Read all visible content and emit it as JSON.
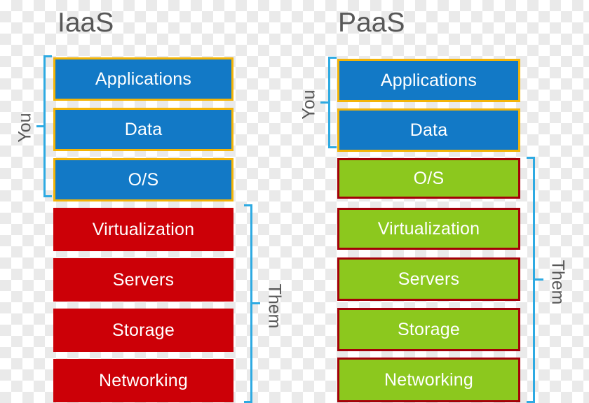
{
  "diagram": {
    "title_left": "IaaS",
    "title_right": "PaaS",
    "colors": {
      "blue_fill": "#1279c6",
      "blue_border": "#f3b408",
      "red_fill": "#cc0007",
      "green_fill": "#8cc81e",
      "green_border": "#a40009",
      "bracket": "#2eaae2",
      "title_text": "#585858",
      "layer_text": "#ffffff"
    }
  },
  "iaas": {
    "title": "IaaS",
    "you_label": "You",
    "them_label": "Them",
    "layers": [
      {
        "label": "Applications",
        "owner": "you",
        "style": "blue"
      },
      {
        "label": "Data",
        "owner": "you",
        "style": "blue"
      },
      {
        "label": "O/S",
        "owner": "you",
        "style": "blue"
      },
      {
        "label": "Virtualization",
        "owner": "them",
        "style": "red"
      },
      {
        "label": "Servers",
        "owner": "them",
        "style": "red"
      },
      {
        "label": "Storage",
        "owner": "them",
        "style": "red"
      },
      {
        "label": "Networking",
        "owner": "them",
        "style": "red"
      }
    ]
  },
  "paas": {
    "title": "PaaS",
    "you_label": "You",
    "them_label": "Them",
    "layers": [
      {
        "label": "Applications",
        "owner": "you",
        "style": "blue"
      },
      {
        "label": "Data",
        "owner": "you",
        "style": "blue"
      },
      {
        "label": "O/S",
        "owner": "them",
        "style": "green"
      },
      {
        "label": "Virtualization",
        "owner": "them",
        "style": "green"
      },
      {
        "label": "Servers",
        "owner": "them",
        "style": "green"
      },
      {
        "label": "Storage",
        "owner": "them",
        "style": "green"
      },
      {
        "label": "Networking",
        "owner": "them",
        "style": "green"
      }
    ]
  }
}
